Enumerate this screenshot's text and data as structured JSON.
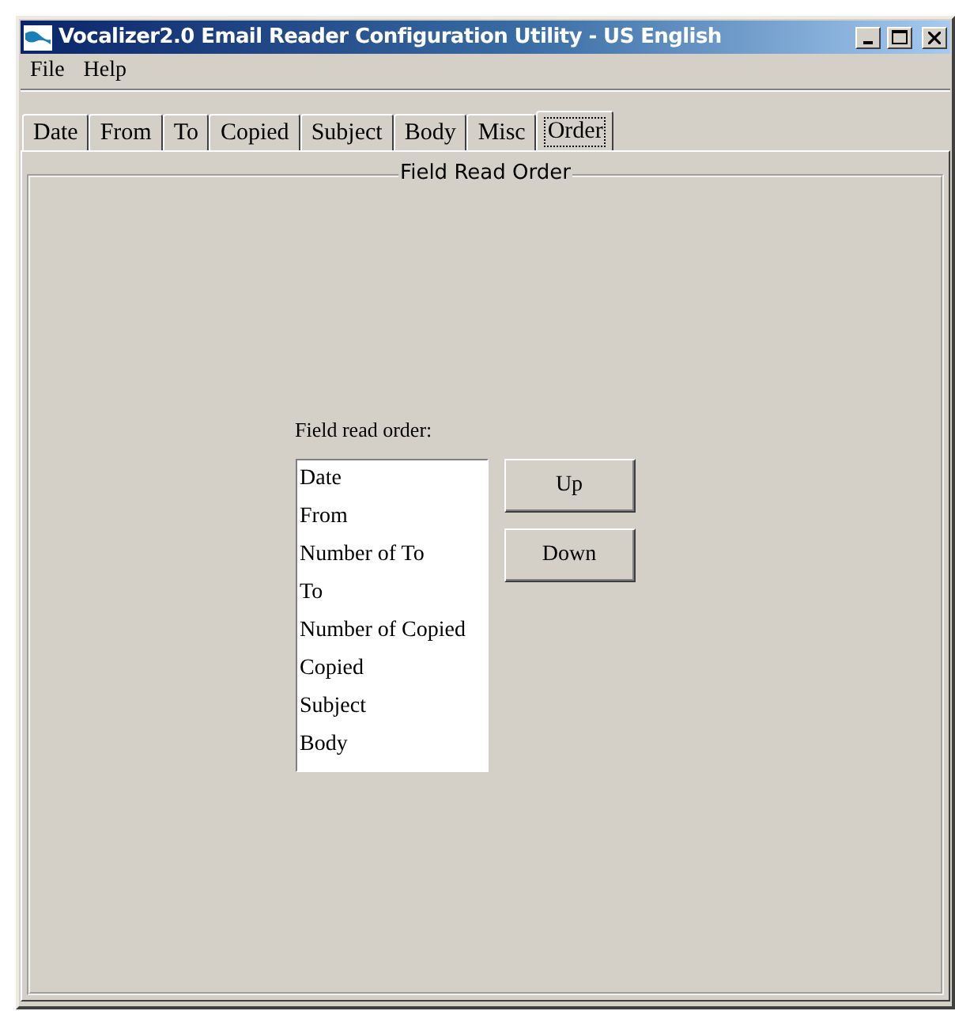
{
  "window": {
    "title": "Vocalizer2.0 Email Reader Configuration Utility - US English"
  },
  "menu": [
    "File",
    "Help"
  ],
  "tabs": [
    {
      "label": "Date",
      "selected": false
    },
    {
      "label": "From",
      "selected": false
    },
    {
      "label": "To",
      "selected": false
    },
    {
      "label": "Copied",
      "selected": false
    },
    {
      "label": "Subject",
      "selected": false
    },
    {
      "label": "Body",
      "selected": false
    },
    {
      "label": "Misc",
      "selected": false
    },
    {
      "label": "Order",
      "selected": true
    }
  ],
  "group": {
    "title": "Field Read Order",
    "label": "Field read order:",
    "items": [
      "Date",
      "From",
      "Number of To",
      "To",
      "Number of Copied",
      "Copied",
      "Subject",
      "Body"
    ],
    "buttons": [
      "Up",
      "Down"
    ]
  }
}
